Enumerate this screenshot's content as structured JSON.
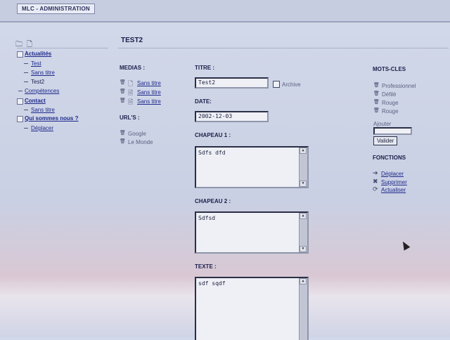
{
  "app": {
    "tab_title": "MLC - ADMINISTRATION"
  },
  "page": {
    "title": "TEST2"
  },
  "tree": {
    "items": [
      {
        "label": "Actualités",
        "level": 1
      },
      {
        "label": "Test",
        "level": 2
      },
      {
        "label": "Sans titre",
        "level": 2
      },
      {
        "label": "Test2",
        "level": 2
      },
      {
        "label": "Compétences",
        "level": 1
      },
      {
        "label": "Contact",
        "level": 1
      },
      {
        "label": "Sans titre",
        "level": 2
      },
      {
        "label": "Qui sommes nous ?",
        "level": 1
      },
      {
        "label": "Déplacer",
        "level": 2
      }
    ]
  },
  "medias": {
    "label": "MEDIAS :",
    "items": [
      "Sans titre",
      "Sans titre",
      "Sans titre"
    ]
  },
  "urls": {
    "label": "URL'S :",
    "items": [
      "Google",
      "Le Monde"
    ]
  },
  "form": {
    "titre_label": "TITRE :",
    "titre_value": "Test2",
    "archive_label": "Archive",
    "date_label": "DATE:",
    "date_value": "2002-12-03",
    "chapeau1_label": "CHAPEAU 1 :",
    "chapeau1_value": "Sdfs dfd",
    "chapeau2_label": "CHAPEAU 2 :",
    "chapeau2_value": "Sdfsd",
    "texte_label": "TEXTE :",
    "texte_value": "sdf sqdf"
  },
  "keywords": {
    "label": "MOTS-CLES",
    "items": [
      "Professionnel",
      "Défilé",
      "Rouge",
      "Rouge"
    ],
    "add_label": "Ajouter",
    "add_value": "",
    "validate_label": "Valider"
  },
  "functions": {
    "label": "FONCTIONS",
    "items": [
      "Déplacer",
      "Supprimer",
      "Actualiser"
    ]
  }
}
